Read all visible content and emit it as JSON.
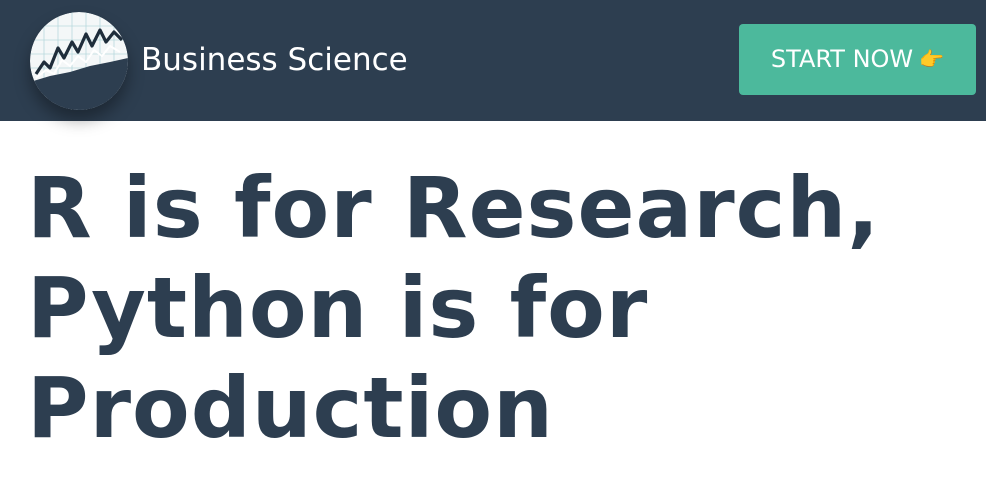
{
  "navbar": {
    "brand_name": "Business Science",
    "cta_label": "START NOW",
    "cta_icon": "👉",
    "colors": {
      "navbar_bg": "#2d3e50",
      "cta_bg": "#4cb99c",
      "headline": "#2d3e50"
    }
  },
  "article": {
    "title_lines": [
      "R is for Research,",
      "Python is for",
      "Production"
    ]
  }
}
